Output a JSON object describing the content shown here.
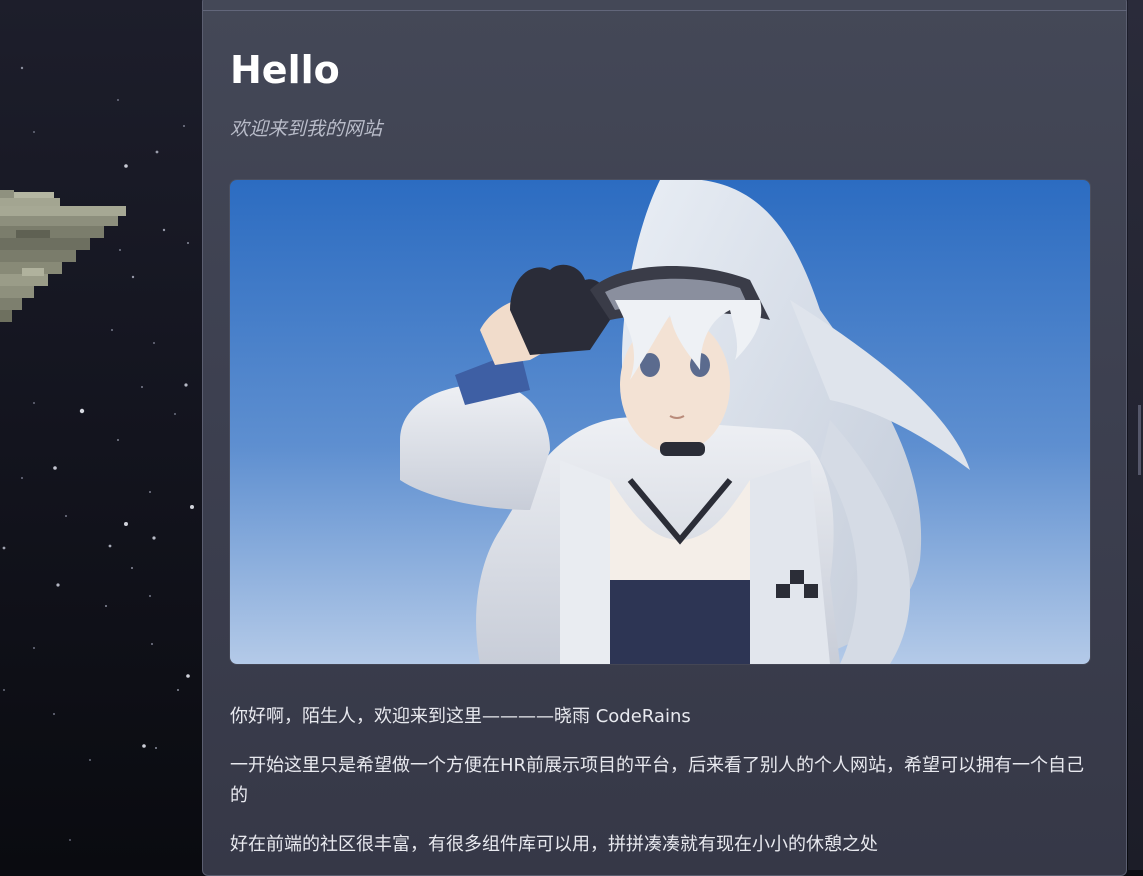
{
  "page": {
    "title": "Hello",
    "subtitle": "欢迎来到我的网站",
    "hero_image": {
      "description_icon": "anime-character-illustration"
    },
    "paragraphs": [
      "你好啊，陌生人，欢迎来到这里————晓雨 CodeRains",
      "一开始这里只是希望做一个方便在HR前展示项目的平台，后来看了别人的个人网站，希望可以拥有一个自己的",
      "好在前端的社区很丰富，有很多组件库可以用，拼拼凑凑就有现在小小的休憩之处"
    ]
  },
  "colors": {
    "card_background": "#3f4252",
    "title": "#ffffff",
    "subtitle": "#b9bcc9",
    "text": "#e8e9ef",
    "sky_top": "#2d6cc0",
    "sky_bottom": "#a9c3e6"
  }
}
